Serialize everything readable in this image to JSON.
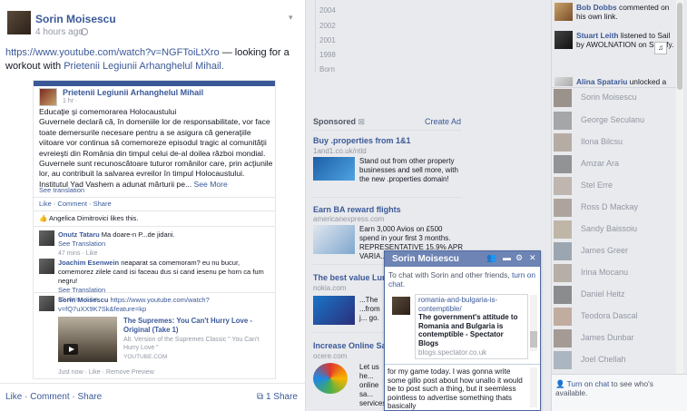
{
  "post": {
    "author": "Sorin Moisescu",
    "time": "4 hours ago",
    "url": "https://www.youtube.com/watch?v=NGFToiLtXro",
    "message_rest": "— looking for a workout with",
    "page_link": "Prietenii Legiunii Arhanghelul Mihail.",
    "like": "Like",
    "comment": "Comment",
    "share": "Share",
    "share_count": "1 Share"
  },
  "screenshot": {
    "page_name": "Prietenii Legiunii Arhanghelul Mihail",
    "page_time": "1 hr ·",
    "body_title": "Educaţie şi comemorarea Holocaustului",
    "body": "Guvernele declară că, în domeniile lor de responsabilitate, vor face toate demersurile necesare pentru a se asigura că generaţiile viitoare vor continua să comemoreze episodul tragic al comunităţii evreieşti din România din timpul celui de-al doilea război mondial. Guvernele sunt recunoscătoare tuturor românilor care, prin acţiunile lor, au contribuit la salvarea evreilor în timpul Holocaustului. Institutul Yad Vashem a adunat mărturii pe...",
    "see_more": "See More",
    "see_translation": "See translation",
    "actions": "Like · Comment · Share",
    "likes": "Angelica Dimitrovici likes this.",
    "c1_name": "Onutz Tataru",
    "c1_text": "Ma doare-n P...de jidani.",
    "c1_meta": "See Translation",
    "c1_time": "47 mins · Like",
    "c2_name": "Joachim Esenwein",
    "c2_text": "neaparat sa comemoram? eu nu bucur, comemorez zilele cand isi faceau dus si cand iesenu pe horn ca fum negru!",
    "c2_meta": "See Translation",
    "c2_time": "25 mins · Like",
    "c3_name": "Sorin Moisescu",
    "c3_text": "https://www.youtube.com/watch?v=fQ7uXX9K7Sk&feature=kp",
    "video_title": "The Supremes: You Can't Hurry Love - Original (Take 1)",
    "video_desc": "Alt. Version of the Supremes Classic \" You Can't Hurry Love \"",
    "video_site": "YOUTUBE.COM",
    "c3_time": "Just now · Like · Remove Preview"
  },
  "timeline_years": [
    "2004",
    "2002",
    "2001",
    "1998",
    "Born"
  ],
  "ads": {
    "heading": "Sponsored",
    "create": "Create Ad",
    "items": [
      {
        "title": "Buy .properties from 1&1",
        "url": "1and1.co.uk/ntld",
        "text": "Stand out from other property businesses and sell more, with the new .properties domain!"
      },
      {
        "title": "Earn BA reward flights",
        "url": "americanexpress.com",
        "text": "Earn 3,000 Avios on £500 spend in your first 3 months. REPRESENTATIVE 15.9% APR VARIA..."
      },
      {
        "title": "The best value Lumia",
        "url": "nokia.com",
        "text": "...The ...from j... go."
      },
      {
        "title": "Increase Online Sales",
        "url": "ocere.com",
        "text": "Let us he... online sa... services"
      }
    ]
  },
  "chat": {
    "title": "Sorin Moisescu",
    "note": "To chat with Sorin and other friends,",
    "note_link": "turn on chat.",
    "link_url": "romania-and-bulgaria-is-contemptible/",
    "link_title": "The government's attitude to Romania and Bulgaria is contemptible - Spectator Blogs",
    "link_domain": "blogs.spectator.co.uk",
    "draft": "for my game today. I was gonna write some gillo post about how unallo it would be to post such a thing, but it seemless pointless to advertise something thats basically"
  },
  "ticker": [
    {
      "name": "Bob Dobbs",
      "text": "commented on his own link."
    },
    {
      "name": "Stuart Leith",
      "text": "listened to Sail by AWOLNATION on Spotify."
    },
    {
      "name": "Alina Spatariu",
      "text": "unlocked a"
    }
  ],
  "contacts": [
    "Sorin Moisescu",
    "George Seculanu",
    "Ilona Bilcsu",
    "Amzar Ara",
    "Stel Erre",
    "Ross D Mackay",
    "Sandy Baissoiu",
    "James Greer",
    "Irina Mocanu",
    "Daniel Heitz",
    "Teodora Dascal",
    "James Dunbar",
    "Joel Chellah"
  ],
  "sidebar_footer": {
    "link": "Turn on chat",
    "text": "to see who's available."
  }
}
